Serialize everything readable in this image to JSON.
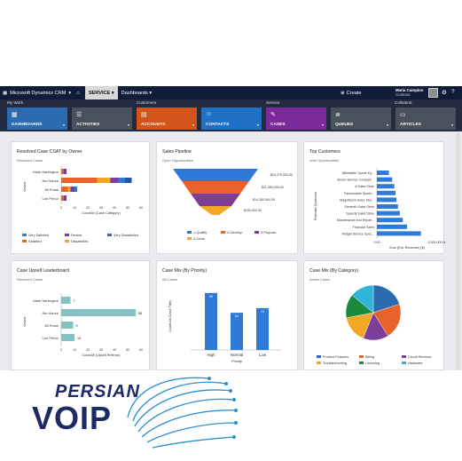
{
  "topbar": {
    "brand": "Microsoft Dynamics CRM",
    "service": "SERVICE",
    "dashboards": "Dashboards",
    "create": "Create",
    "user_name": "Maria Campion",
    "user_org": "Contoso",
    "home_icon": "home-icon",
    "gear_icon": "gear-icon",
    "help_icon": "help-icon"
  },
  "ribbon": {
    "groups": [
      "My Work",
      "Customers",
      "Service",
      "Collateral"
    ],
    "tiles": [
      {
        "label": "DASHBOARDS",
        "color": "#2b6cb0",
        "icon": "dashboard-icon"
      },
      {
        "label": "ACTIVITIES",
        "color": "#4b515c",
        "icon": "activities-icon"
      },
      {
        "label": "ACCOUNTS",
        "color": "#d2541b",
        "icon": "accounts-icon"
      },
      {
        "label": "CONTACTS",
        "color": "#1f71c6",
        "icon": "contacts-icon"
      },
      {
        "label": "CASES",
        "color": "#7b2a99",
        "icon": "cases-icon"
      },
      {
        "label": "QUEUES",
        "color": "#4b515c",
        "icon": "queues-icon"
      },
      {
        "label": "ARTICLES",
        "color": "#4b515c",
        "icon": "articles-icon"
      }
    ]
  },
  "cards": [
    {
      "title": "Resolved Case CSAT by Owner",
      "subtitle": "Resolved Cases"
    },
    {
      "title": "Sales Pipeline",
      "subtitle": "Open Opportunities"
    },
    {
      "title": "Top Customers",
      "subtitle": "Won Opportunities"
    },
    {
      "title": "Case Upsell Leaderboard",
      "subtitle": "Resolved Cases"
    },
    {
      "title": "Case Mix (By Priority)",
      "subtitle": "All Cases"
    },
    {
      "title": "Case Mix (By Category)",
      "subtitle": "Active Cases"
    }
  ],
  "logo": {
    "line1": "PERSIAN",
    "line2": "VOIP"
  },
  "chart_data": [
    {
      "type": "bar",
      "orientation": "horizontal",
      "stacked": true,
      "categories": [
        "Mark Harrington",
        "Jim Hance",
        "Jill Frank",
        "Lori Penor"
      ],
      "series": [
        {
          "name": "Very Satisfied",
          "color": "#2f7ad8",
          "values": [
            0,
            5,
            2,
            0
          ]
        },
        {
          "name": "Neutral",
          "color": "#7b3f99",
          "values": [
            2,
            6,
            3,
            2
          ]
        },
        {
          "name": "Very Dissatisfied",
          "color": "#3a6ab5",
          "values": [
            0,
            0,
            0,
            0
          ]
        },
        {
          "name": "Satisfied",
          "color": "#e8622a",
          "values": [
            2,
            27,
            5,
            2
          ]
        },
        {
          "name": "Dissatisfied",
          "color": "#f2a825",
          "values": [
            0,
            10,
            2,
            0
          ]
        },
        {
          "name": "",
          "color": "#2853a8",
          "values": [
            0,
            5,
            0,
            0
          ]
        }
      ],
      "xlabel": "CountAll (Case Category)",
      "ylabel": "Owner",
      "xticks": [
        0,
        10,
        20,
        30,
        40,
        50,
        60
      ],
      "xlim": [
        0,
        60
      ]
    },
    {
      "type": "funnel",
      "categories": [
        "1-Qualify",
        "2-Develop",
        "3-Propose",
        "4-Close"
      ],
      "values": [
        24270000,
        11350000,
        14350000,
        100000
      ],
      "labels": [
        "$24,270,000.00",
        "$11,350,000.00",
        "$14,350,000.00",
        "$100,000.00"
      ],
      "colors": [
        "#2f7ad8",
        "#e8622a",
        "#7b3f99",
        "#f2a825"
      ]
    },
    {
      "type": "bar",
      "orientation": "horizontal",
      "categories": [
        "Affordable Sports Eq...",
        "Brown Service Compani...",
        "A Sales Store",
        "Fashionable Sports...",
        "Magnificent Sales Stor...",
        "Eleventh Sales Store",
        "Speedy Sales Store",
        "Maintenance and Repair...",
        "Financial Sales",
        "Widget Service Spec..."
      ],
      "values": [
        400000,
        510000,
        580000,
        620000,
        650000,
        700000,
        760000,
        860000,
        1000000,
        1460000
      ],
      "xlabel": "Sum (Est. Revenue) ($)",
      "ylabel": "Potential Customer",
      "xticks": [
        "0.00",
        "2,000,000.00"
      ],
      "xlim": [
        0,
        2000000
      ],
      "color": "#2f7ad8"
    },
    {
      "type": "bar",
      "orientation": "horizontal",
      "categories": [
        "Mark Harrington",
        "Jim Hance",
        "Jill Frank",
        "Lori Penor"
      ],
      "values": [
        7,
        56,
        9,
        10
      ],
      "xlabel": "CountAll (Upsell Referral)",
      "ylabel": "Owner",
      "xticks": [
        0,
        10,
        20,
        30,
        40,
        50,
        60
      ],
      "xlim": [
        0,
        60
      ],
      "color": "#84c1c2"
    },
    {
      "type": "bar",
      "categories": [
        "High",
        "Normal",
        "Low"
      ],
      "values": [
        98,
        64,
        72
      ],
      "xlabel": "Priority",
      "ylabel": "Count:All (Case Title)",
      "ylim": [
        0,
        110
      ],
      "color": "#2f7ad8"
    },
    {
      "type": "pie",
      "categories": [
        "Product Features",
        "Billing",
        "Circuit Services",
        "Troubleshooting",
        "Licensing",
        "Hardware"
      ],
      "values": [
        20,
        21,
        15,
        16,
        14,
        14
      ],
      "colors": [
        "#2b6cb0",
        "#e8622a",
        "#7b3f99",
        "#f2a825",
        "#1b8a3e",
        "#2fb3d8"
      ]
    }
  ]
}
